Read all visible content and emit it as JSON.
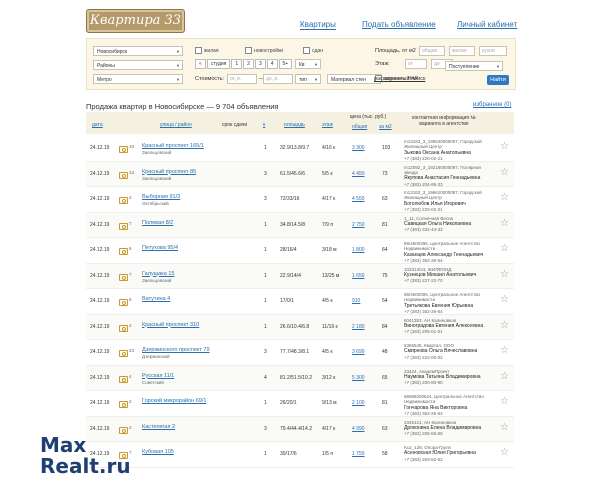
{
  "header": {
    "logo": "Квартира 33",
    "nav": [
      {
        "label": "Квартиры",
        "active": true
      },
      {
        "label": "Подать объявление",
        "active": false
      },
      {
        "label": "Личный кабинет",
        "active": false
      }
    ]
  },
  "filters": {
    "city": "Новосибирск",
    "districts": "Районы",
    "metro": "Метро",
    "types": [
      "жилая",
      "новостройки",
      "сдан"
    ],
    "studio": "студия",
    "rooms": [
      "1",
      "2",
      "3",
      "4",
      "5+"
    ],
    "price_label": "Стоимость:",
    "price_from_ph": "от, р.",
    "price_to_ph": "до, р.",
    "currency": "Кв",
    "type_sel": "тип",
    "material": "Материал стен",
    "area_label": "Площадь, от м2",
    "area_fields": [
      "общая",
      "жилая",
      "кухня"
    ],
    "floor_label": "Этаж:",
    "floor_from_ph": "от",
    "floor_to_ph": "до",
    "nap": "варианты НАР",
    "sort": "Поступление",
    "advanced": "расширенный поиск",
    "find": "Найти"
  },
  "results": {
    "title": "Продажа квартир в Новосибирске — 9 704 объявления",
    "favorites": "избранное (0)",
    "headers": {
      "date": "дата",
      "street": "улица / район",
      "term": "срок сдачи",
      "rooms": "к",
      "area": "площадь",
      "floor": "этаж",
      "price_top": "цена (тыс. руб.)",
      "price_total": "общая",
      "price_m2": "за м2",
      "agent": "контактная информация № варианта в агентстве"
    },
    "rows": [
      {
        "date": "24.12.19",
        "photos": "10",
        "street": "Красный проспект 165/1",
        "district": "Заельцовский",
        "rooms": "1",
        "area": "32.9/13.8/9.7",
        "floor": "4/16 к",
        "price": "3 300",
        "m2": "103",
        "a1": "m13163_3_195540000007, Городской",
        "a2": "Жилищный Центр",
        "name": "Зыкова Оксана Анатольевна",
        "phone": "+7 (383) 220-02-21"
      },
      {
        "date": "24.12.19",
        "photos": "13",
        "street": "Красный проспект 85",
        "district": "Заельцовский",
        "rooms": "3",
        "area": "61.5/45.6/6",
        "floor": "5/5 к",
        "price": "4 450",
        "m2": "73",
        "a1": "m12092_3_192160000097, Полярная",
        "a2": "звезда",
        "name": "Якупова Анастасия Геннадьевна",
        "phone": "+7 (383) 204-99-33"
      },
      {
        "date": "24.12.19",
        "photos": "2",
        "street": "Выборная 91/3",
        "district": "Октябрьский",
        "rooms": "3",
        "area": "72/33/16",
        "floor": "4/17 к",
        "price": "4 550",
        "m2": "63",
        "a1": "m13163_3_196610000087, Городской",
        "a2": "Жилищный Центр",
        "name": "Боголюбов Илья Игоревич",
        "phone": "+7 (383) 220-02-21"
      },
      {
        "date": "24.12.19",
        "photos": "7",
        "street": "Полевая 8/2",
        "district": "",
        "rooms": "1",
        "area": "34.8/14.5/8",
        "floor": "7/9 п",
        "price": "2 750",
        "m2": "81",
        "a1": "1_11, Солнечная Весна",
        "a2": "",
        "name": "Савицкая Ольга Николаевна",
        "phone": "+7 (383) 332-44-33"
      },
      {
        "date": "24.12.19",
        "photos": "6",
        "street": "Петухова 95/4",
        "district": "",
        "rooms": "1",
        "area": "28/16/4",
        "floor": "3/18 м",
        "price": "1 800",
        "m2": "64",
        "a1": "66/4600396, Центральное Агентство",
        "a2": "Недвижимости",
        "name": "Казанцев Александр Геннадьевич",
        "phone": "+7 (383) 362-26-64"
      },
      {
        "date": "24.12.19",
        "photos": "7",
        "street": "Галущака 15",
        "district": "Заельцовский",
        "rooms": "1",
        "area": "22.9/14/4",
        "floor": "13/25 м",
        "price": "1 650",
        "m2": "75",
        "a1": "103313/24, ЖИЛФОНД",
        "a2": "",
        "name": "Кузнецов Михаил Анатольевич",
        "phone": "+7 (383) 227-22-70"
      },
      {
        "date": "24.12.19",
        "photos": "6",
        "street": "Ватутина 4",
        "district": "",
        "rooms": "1",
        "area": "17/0/1",
        "floor": "4/5 к",
        "price": "910",
        "m2": "54",
        "a1": "66/4600395, Центральное Агентство",
        "a2": "Недвижимости",
        "name": "Третьякова Евгения Юрьевна",
        "phone": "+7 (383) 362-26-64"
      },
      {
        "date": "24.12.19",
        "photos": "2",
        "street": "Красный проспект 310",
        "district": "",
        "rooms": "1",
        "area": "26.6/10.4/6.8",
        "floor": "11/19 к",
        "price": "2 180",
        "m2": "84",
        "a1": "6041353, АН Калиновков",
        "a2": "",
        "name": "Виноградова Евгения Алексеевна",
        "phone": "+7 (383) 205-01-01"
      },
      {
        "date": "24.12.19",
        "photos": "23",
        "street": "Дзержинского проспект 79",
        "district": "Дзержинский",
        "rooms": "3",
        "area": "77.7/48.3/8.1",
        "floor": "4/5 к",
        "price": "3 699",
        "m2": "48",
        "a1": "5365545, Квартал, ООО",
        "a2": "",
        "name": "Смирнова Ольга Вячеславовна",
        "phone": "+7 (383) 222-00-02"
      },
      {
        "date": "24.12.19",
        "photos": "4",
        "street": "Русская 11/1",
        "district": "Советский",
        "rooms": "4",
        "area": "81.2/51.5/10.2",
        "floor": "3/12 к",
        "price": "5 300",
        "m2": "65",
        "a1": "23424, АкадемПроект",
        "a2": "",
        "name": "Наумова Татьяна Владимировна",
        "phone": "+7 (383) 200-80-90"
      },
      {
        "date": "24.12.19",
        "photos": "2",
        "street": "Горский микрорайон 69/1",
        "district": "",
        "rooms": "1",
        "area": "26/20/1",
        "floor": "9/13 м",
        "price": "2 100",
        "m2": "81",
        "a1": "66658200624, Центральное Агентство",
        "a2": "Недвижимости",
        "name": "Гончарова Яна Викторовна",
        "phone": "+7 (383) 362-26-64"
      },
      {
        "date": "24.12.19",
        "photos": "2",
        "street": "Кастелягая 2",
        "district": "",
        "rooms": "3",
        "area": "79.4/44.4/14.2",
        "floor": "4/17 к",
        "price": "4 990",
        "m2": "63",
        "a1": "3346121, АН Калиновков",
        "a2": "",
        "name": "Дроконина Елена Владимировна",
        "phone": "+7 (383) 205-55-55"
      },
      {
        "date": "24.12.19",
        "photos": "7",
        "street": "Кубовая 105",
        "district": "",
        "rooms": "1",
        "area": "30/17/6",
        "floor": "1/5 п",
        "price": "1 750",
        "m2": "58",
        "a1": "Kuz_128, Опора-Групп",
        "a2": "",
        "name": "Асеновская Юлия Григорьевна",
        "phone": "+7 (383) 263-62-52"
      }
    ]
  },
  "watermark": {
    "line1": "Max",
    "line2": "Realt.ru"
  }
}
